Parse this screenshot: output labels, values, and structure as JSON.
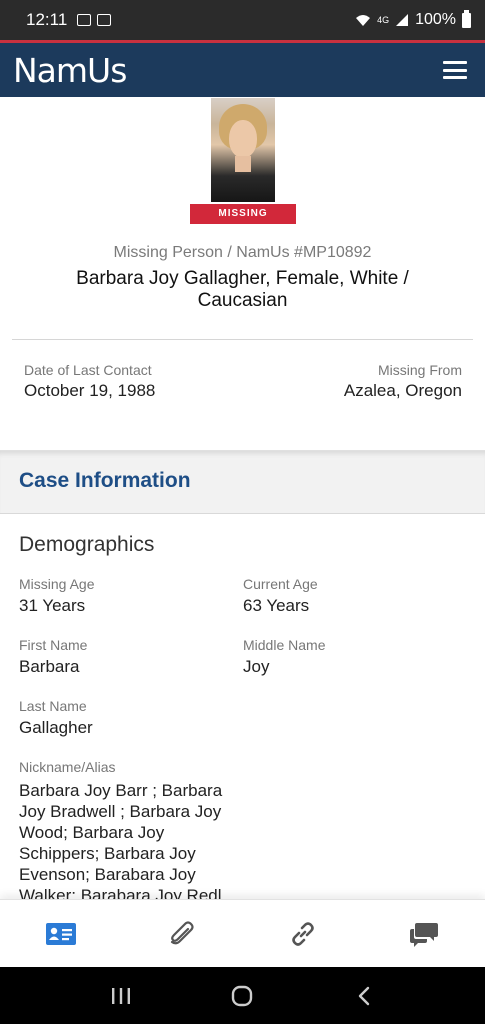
{
  "status_bar": {
    "time": "12:11",
    "network": "4G",
    "battery": "100%"
  },
  "app": {
    "logo": "NamUs"
  },
  "profile": {
    "status_badge": "MISSING",
    "case_number": "Missing Person / NamUs #MP10892",
    "name": "Barbara Joy Gallagher, Female, White / Caucasian",
    "last_contact_label": "Date of Last Contact",
    "last_contact_value": "October 19, 1988",
    "missing_from_label": "Missing From",
    "missing_from_value": "Azalea, Oregon"
  },
  "case_info": {
    "title": "Case Information"
  },
  "demographics": {
    "title": "Demographics",
    "missing_age_label": "Missing Age",
    "missing_age_value": "31 Years",
    "current_age_label": "Current Age",
    "current_age_value": "63 Years",
    "first_name_label": "First Name",
    "first_name_value": "Barbara",
    "middle_name_label": "Middle Name",
    "middle_name_value": "Joy",
    "last_name_label": "Last Name",
    "last_name_value": "Gallagher",
    "alias_label": "Nickname/Alias",
    "alias_value": "Barbara Joy Barr ; Barbara Joy Bradwell ; Barbara Joy Wood; Barbara Joy Schippers; Barbara Joy Evenson; Barabara Joy Walker; Barabara Joy Redl"
  },
  "tabs": [
    {
      "icon": "id-card-icon",
      "active": true
    },
    {
      "icon": "paperclip-icon",
      "active": false
    },
    {
      "icon": "link-icon",
      "active": false
    },
    {
      "icon": "chat-icon",
      "active": false
    }
  ],
  "colors": {
    "header": "#1c3a5c",
    "accent_red": "#d2283a",
    "case_info_blue": "#1e4e86",
    "active_tab": "#2b7bd6",
    "inactive_tab": "#555555"
  }
}
